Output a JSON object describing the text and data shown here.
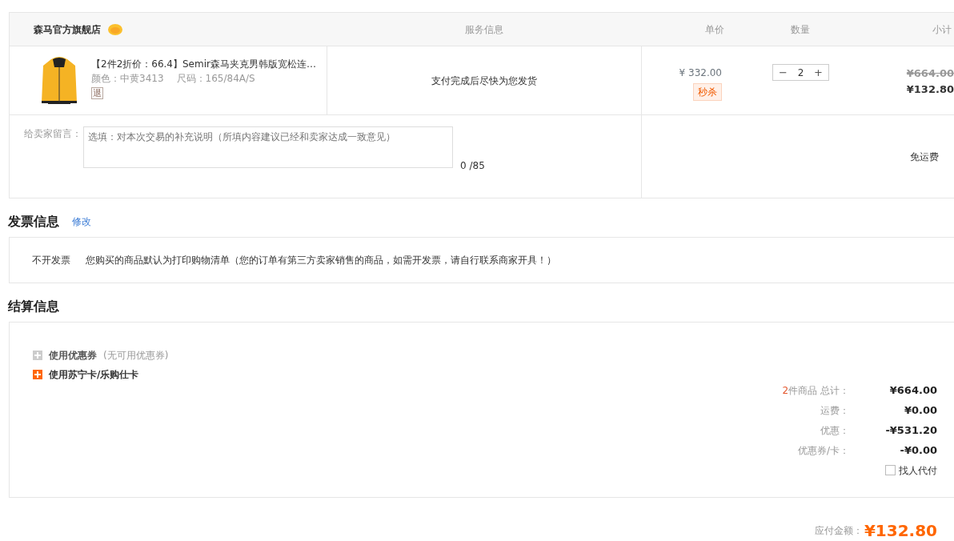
{
  "order": {
    "store": "森马官方旗舰店",
    "columns": [
      "服务信息",
      "单价",
      "数量",
      "小计"
    ],
    "item": {
      "title": "【2件2折价：66.4】Semir森马夹克男韩版宽松连…",
      "variant": "颜色：中黄3413",
      "size": "尺码：165/84A/S",
      "return_tag": "退",
      "service": "支付完成后尽快为您发货",
      "price": "¥ 332.00",
      "promo_tag": "秒杀",
      "quantity": "2",
      "minus": "−",
      "plus": "+",
      "original_subtotal": "¥664.00",
      "subtotal": "¥132.80"
    },
    "message": {
      "label": "给卖家留言：",
      "placeholder": "选填：对本次交易的补充说明（所填内容建议已经和卖家达成一致意见）",
      "counter": "0 /85"
    },
    "shipping": "免运费"
  },
  "invoice": {
    "title": "发票信息",
    "edit_link": "修改",
    "type": "不开发票",
    "note": "您购买的商品默认为打印购物清单（您的订单有第三方卖家销售的商品，如需开发票，请自行联系商家开具！）"
  },
  "settlement": {
    "title": "结算信息",
    "options": [
      {
        "label": "使用优惠券",
        "note": "(无可用优惠券)",
        "disabled": true
      },
      {
        "label": "使用苏宁卡/乐购仕卡",
        "disabled": false
      }
    ],
    "summary": [
      {
        "count": "2",
        "label": "件商品 总计：",
        "value": "¥664.00"
      },
      {
        "label": "运费：",
        "value": "¥0.00"
      },
      {
        "label": "优惠：",
        "value": "-¥531.20"
      },
      {
        "label": "优惠券/卡：",
        "value": "-¥0.00"
      }
    ],
    "pay_for_me": {
      "label": "找人代付",
      "checked": false
    }
  },
  "total": {
    "label": "应付金额：",
    "value": "¥132.80"
  }
}
